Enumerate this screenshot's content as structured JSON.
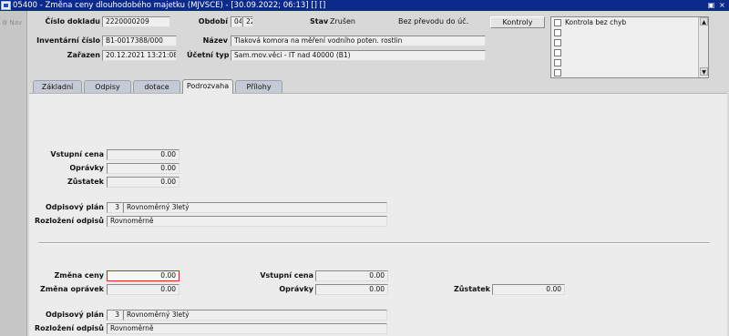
{
  "window": {
    "title": "05400 - Změna ceny dlouhodobého majetku (MJVSCE) - [30.09.2022; 06:13] [] []",
    "restore_glyph": "▣",
    "close_glyph": "×"
  },
  "sidebar": {
    "nav_label": "Nav"
  },
  "header": {
    "cislo_dokladu_label": "Číslo dokladu",
    "cislo_dokladu": "2220000209",
    "obdobi_label": "Období",
    "obdobi_month": "04",
    "obdobi_year": "22",
    "stav_label": "Stav",
    "stav_value": "Zrušen",
    "prevod_text": "Bez převodu do úč.",
    "kontroly_button": "Kontroly",
    "inventarni_cislo_label": "Inventární číslo",
    "inventarni_cislo": "B1-0017388/000",
    "nazev_label": "Název",
    "nazev": "Tlaková komora na měření vodního poten. rostlin",
    "zarazen_label": "Zařazen",
    "zarazen": "20.12.2021 13:21:08",
    "ucetni_typ_label": "Účetní typ",
    "ucetni_typ": "Sam.mov.věci - IT nad 40000 (B1)"
  },
  "checklist": {
    "items": [
      "Kontrola bez chyb",
      "",
      "",
      "",
      "",
      ""
    ],
    "scroll_up": "▲",
    "scroll_down": "▼"
  },
  "tabs": [
    "Základní",
    "Odpisy",
    "dotace",
    "Podrozvaha",
    "Přílohy"
  ],
  "active_tab": "Podrozvaha",
  "top_section": {
    "vstupni_cena_label": "Vstupní cena",
    "vstupni_cena": "0.00",
    "opravky_label": "Oprávky",
    "opravky": "0.00",
    "zustatek_label": "Zůstatek",
    "zustatek": "0.00",
    "odpisovy_plan_label": "Odpisový plán",
    "odpisovy_plan_code": "3",
    "odpisovy_plan_name": "Rovnoměrný 3letý",
    "rozlozeni_odpisu_label": "Rozložení odpisů",
    "rozlozeni_odpisu": "Rovnoměrně"
  },
  "bottom_section": {
    "zmena_ceny_label": "Změna ceny",
    "zmena_ceny": "0.00",
    "zmena_opravek_label": "Změna oprávek",
    "zmena_opravek": "0.00",
    "vstupni_cena_label": "Vstupní cena",
    "vstupni_cena": "0.00",
    "opravky_label": "Oprávky",
    "opravky": "0.00",
    "zustatek_label": "Zůstatek",
    "zustatek": "0.00",
    "odpisovy_plan_label": "Odpisový plán",
    "odpisovy_plan_code": "3",
    "odpisovy_plan_name": "Rovnoměrný 3letý",
    "rozlozeni_odpisu_label": "Rozložení odpisů",
    "rozlozeni_odpisu": "Rovnoměrně"
  },
  "colors": {
    "titlebar": "#0b2a8a",
    "panel": "#ececec",
    "tab_inactive": "#c5cad6",
    "active_field_border": "#dd2222"
  }
}
